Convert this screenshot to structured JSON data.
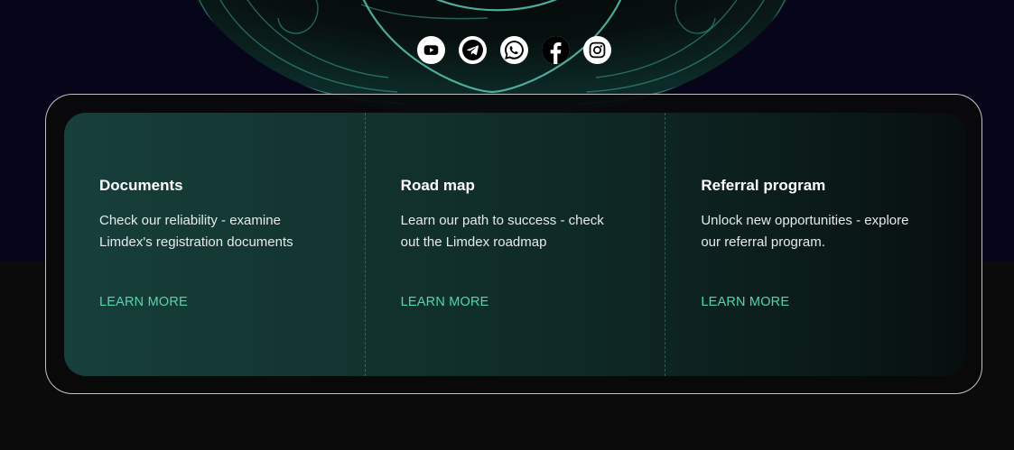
{
  "social": [
    {
      "name": "youtube-icon"
    },
    {
      "name": "telegram-icon"
    },
    {
      "name": "whatsapp-icon"
    },
    {
      "name": "facebook-icon"
    },
    {
      "name": "instagram-icon"
    }
  ],
  "cards": [
    {
      "title": "Documents",
      "text": "Check our reliability - examine Limdex's registration documents",
      "link": "LEARN MORE"
    },
    {
      "title": "Road map",
      "text": "Learn our path to success - check out the Limdex roadmap",
      "link": "LEARN MORE"
    },
    {
      "title": "Referral program",
      "text": "Unlock new opportunities - explore our referral program.",
      "link": "LEARN MORE"
    }
  ],
  "colors": {
    "accent": "#52d8a8",
    "card_gradient_start": "#173f3b",
    "card_gradient_end": "#070f0e",
    "top_background": "#06051a",
    "bottom_background": "#0b0b0b"
  }
}
